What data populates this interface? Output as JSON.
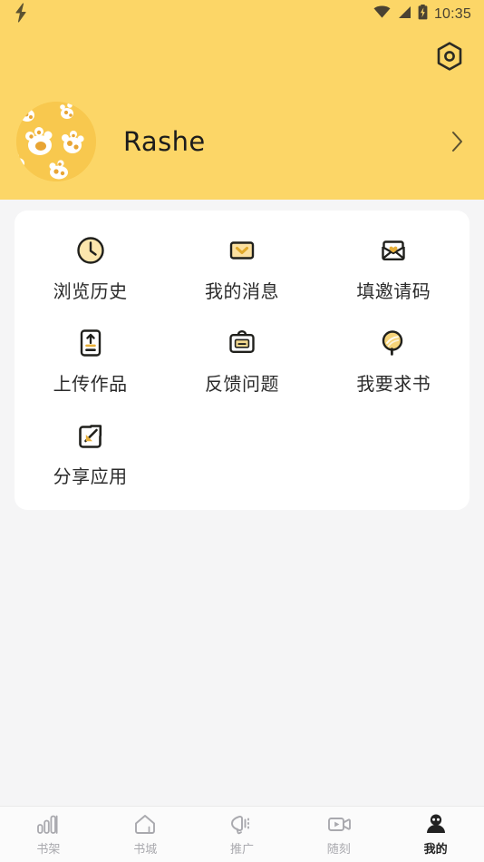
{
  "status_bar": {
    "left_icon": "lightning-bolt-icon",
    "wifi_icon": "wifi-icon",
    "signal_icon": "signal-icon",
    "battery_icon": "battery-charging-icon",
    "time": "10:35"
  },
  "header": {
    "background_color": "#fcd667",
    "settings_icon": "hex-gear-icon",
    "avatar_icon": "paw-avatar",
    "username": "Rashe",
    "chevron_icon": "chevron-right-icon"
  },
  "menu": {
    "items": [
      {
        "label": "浏览历史",
        "icon": "clock-icon"
      },
      {
        "label": "我的消息",
        "icon": "message-envelope-icon"
      },
      {
        "label": "填邀请码",
        "icon": "invite-envelope-heart-icon"
      },
      {
        "label": "上传作品",
        "icon": "upload-icon"
      },
      {
        "label": "反馈问题",
        "icon": "feedback-clipboard-icon"
      },
      {
        "label": "我要求书",
        "icon": "search-book-icon"
      },
      {
        "label": "分享应用",
        "icon": "share-external-icon"
      }
    ]
  },
  "tabbar": {
    "items": [
      {
        "label": "书架",
        "icon": "bookshelf-bars-icon",
        "active": false
      },
      {
        "label": "书城",
        "icon": "bookstore-home-icon",
        "active": false
      },
      {
        "label": "推广",
        "icon": "promote-megaphone-icon",
        "active": false
      },
      {
        "label": "随刻",
        "icon": "video-icon",
        "active": false
      },
      {
        "label": "我的",
        "icon": "profile-person-icon",
        "active": true
      }
    ]
  },
  "colors": {
    "accent": "#fcd667",
    "accent_deep": "#f0b429",
    "card": "#ffffff",
    "page_bg": "#f5f5f6",
    "text": "#2b2b2b",
    "tab_inactive": "#a9a9ae"
  }
}
